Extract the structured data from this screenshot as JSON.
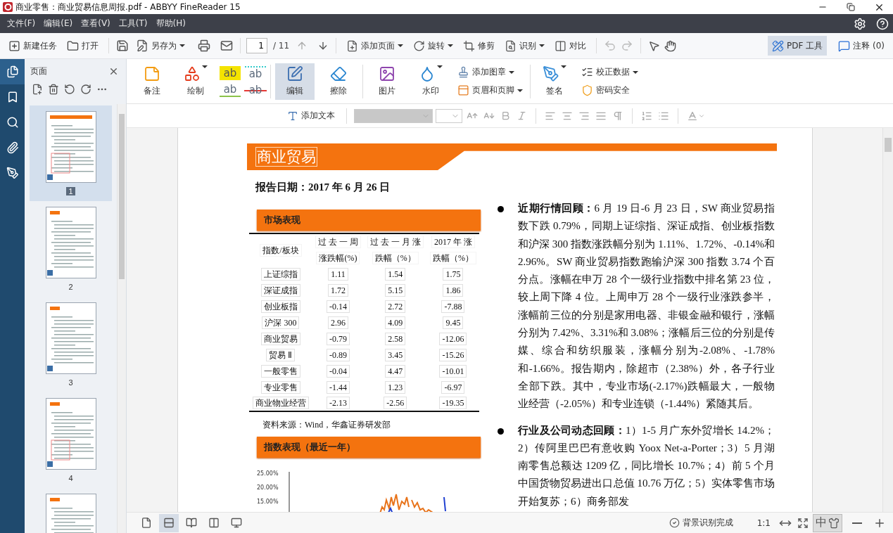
{
  "window": {
    "title": "商业零售：商业贸易信息周报.pdf - ABBYY FineReader 15"
  },
  "menu": [
    "文件(F)",
    "编辑(E)",
    "查看(V)",
    "工具(T)",
    "帮助(H)"
  ],
  "toolbar": {
    "file_buttons": [
      {
        "label": "新建任务",
        "dropdown": false
      },
      {
        "label": "打开",
        "dropdown": false
      }
    ],
    "save_as": {
      "label": "另存为",
      "dropdown": true
    },
    "page": {
      "value": "1",
      "total": "/ 11"
    },
    "tools": [
      {
        "label": "添加页面",
        "dropdown": true
      },
      {
        "label": "旋转",
        "dropdown": true
      },
      {
        "label": "修剪",
        "dropdown": false
      },
      {
        "label": "识别",
        "dropdown": true
      },
      {
        "label": "对比",
        "dropdown": false
      }
    ],
    "modes": [
      {
        "label": "PDF 工具",
        "selected": true
      },
      {
        "label": "注释 (0)",
        "selected": false
      }
    ]
  },
  "rail": [
    {
      "selected": true
    },
    {
      "selected": false
    },
    {
      "selected": false
    },
    {
      "selected": false
    },
    {
      "selected": false
    }
  ],
  "pages_panel": {
    "title": "页面",
    "pages": [
      {
        "label": "1",
        "selected": true
      },
      {
        "label": "2",
        "selected": false
      },
      {
        "label": "3",
        "selected": false
      },
      {
        "label": "4",
        "selected": false
      },
      {
        "selected": false
      }
    ]
  },
  "ribbon": [
    {
      "items": [
        {
          "kind": "large",
          "label": "备注",
          "dropdown": false,
          "selected": false
        },
        {
          "kind": "large",
          "label": "绘制",
          "dropdown": true,
          "selected": false
        },
        {
          "kind": "markup",
          "marks": [
            {
              "text": "ab"
            },
            {
              "text": "ab"
            },
            {
              "text": "ab"
            },
            {
              "text": "ab"
            }
          ]
        }
      ]
    },
    {
      "items": [
        {
          "kind": "large",
          "label": "编辑",
          "dropdown": false,
          "selected": true
        },
        {
          "kind": "large",
          "label": "擦除",
          "dropdown": false,
          "selected": false
        }
      ]
    },
    {
      "items": [
        {
          "kind": "large",
          "label": "图片",
          "dropdown": false,
          "selected": false
        },
        {
          "kind": "large",
          "label": "水印",
          "dropdown": true,
          "selected": false
        },
        {
          "kind": "stack",
          "entries": [
            {
              "label": "添加图章",
              "dropdown": true
            },
            {
              "label": "页眉和页脚",
              "dropdown": true
            }
          ]
        }
      ]
    },
    {
      "items": [
        {
          "kind": "large",
          "label": "签名",
          "dropdown": true,
          "selected": false
        },
        {
          "kind": "stack",
          "entries": [
            {
              "label": "校正数据",
              "dropdown": true
            },
            {
              "label": "密码安全",
              "dropdown": false
            }
          ]
        }
      ]
    }
  ],
  "format_bar": {
    "add_text": "添加文本"
  },
  "document": {
    "title": "商业贸易",
    "report_date": "报告日期：2017 年 6 月 26 日",
    "market": {
      "heading": "市场表现",
      "columns": [
        {
          "label": "指数/板块"
        },
        {
          "label": "过 去 一 周",
          "sub": "涨跌幅(%)"
        },
        {
          "label": "过 去 一 月 涨",
          "sub": "跌幅（%）"
        },
        {
          "label": "2017  年 涨",
          "sub": "跌幅（%）"
        }
      ],
      "rows": [
        [
          "上证综指",
          "1.11",
          "1.54",
          "1.75"
        ],
        [
          "深证成指",
          "1.72",
          "5.15",
          "1.86"
        ],
        [
          "创业板指",
          "-0.14",
          "2.72",
          "-7.88"
        ],
        [
          "沪深 300",
          "2.96",
          "4.09",
          "9.45"
        ],
        [
          "商业贸易",
          "-0.79",
          "2.58",
          "-12.06"
        ],
        [
          "贸易 Ⅱ",
          "-0.89",
          "3.45",
          "-15.26"
        ],
        [
          "一般零售",
          "-0.04",
          "4.47",
          "-10.01"
        ],
        [
          "专业零售",
          "-1.44",
          "1.23",
          "-6.97"
        ],
        [
          "商业物业经营",
          "-2.13",
          "-2.56",
          "-19.35"
        ]
      ],
      "source": "资料来源：Wind，华鑫证券研发部"
    },
    "index_chart": {
      "heading": "指数表现（最近一年）",
      "axis_labels": [
        "25.00%",
        "20.00%",
        "15.00%"
      ]
    },
    "bullets": [
      "**近期行情回顾：**6 月 19 日-6 月 23 日，SW 商业贸易指数下跌 0.79%，同期上证综指、深证成指、创业板指数和沪深 300 指数涨跌幅分别为 1.11%、1.72%、-0.14%和 2.96%。SW 商业贸易指数跑输沪深 300 指数 3.74 个百分点。涨幅在申万 28 个一级行业指数中排名第 23 位，较上周下降 4 位。上周申万 28 个一级行业涨跌参半，涨幅前三位的分别是家用电器、非银金融和银行，涨幅分别为 7.42%、3.31%和 3.08%；涨幅后三位的分别是传媒、综合和纺织服装，涨幅分别为-2.08%、-1.78%和-1.66%。报告期内，除超市（2.38%）外，各子行业全部下跌。其中，专业市场(-2.17%)跌幅最大，一般物业经营（-2.05%）和专业连锁（-1.44%）紧随其后。",
      "**行业及公司动态回顾：**1）1-5 月广东外贸增长 14.2%；2）传阿里巴巴有意收购 Yoox Net-a-Porter；3）5 月湖南零售总额达 1209 亿，同比增长 10.7%；4）前 5 个月中国货物贸易进出口总值 10.76 万亿；5）实体零售市场开始复苏；6）商务部发"
    ]
  },
  "status_bar": {
    "view_modes": [
      {
        "selected": false
      },
      {
        "selected": true
      },
      {
        "selected": false
      },
      {
        "selected": false
      },
      {
        "selected": false
      }
    ],
    "recognition": "背景识别完成",
    "zoom_reset": "1:1",
    "ime": "中"
  }
}
